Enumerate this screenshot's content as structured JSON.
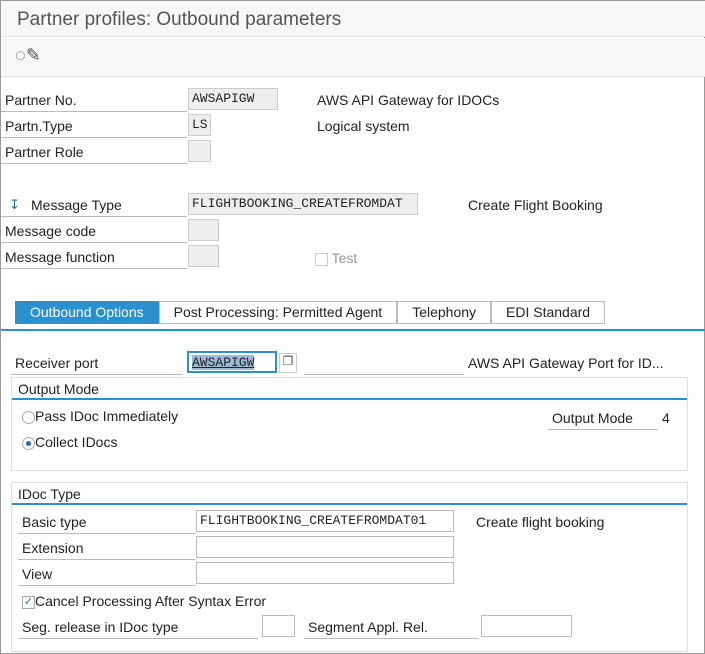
{
  "title": "Partner profiles: Outbound parameters",
  "toolbar": {
    "display_change_icon": "glasses-pencil-icon"
  },
  "header": {
    "partner_no_label": "Partner No.",
    "partner_no": "AWSAPIGW",
    "partner_no_desc": "AWS API Gateway for IDOCs",
    "partn_type_label": "Partn.Type",
    "partn_type": "LS",
    "partn_type_desc": "Logical system",
    "partner_role_label": "Partner Role",
    "partner_role": "",
    "message_type_label": "Message Type",
    "message_type": "FLIGHTBOOKING_CREATEFROMDAT",
    "message_type_desc": "Create Flight Booking",
    "message_code_label": "Message code",
    "message_function_label": "Message function",
    "test_label": "Test"
  },
  "tabs": [
    "Outbound Options",
    "Post Processing: Permitted Agent",
    "Telephony",
    "EDI Standard"
  ],
  "outbound": {
    "receiver_port_label": "Receiver port",
    "receiver_port": "AWSAPIGW",
    "receiver_port_desc": "AWS API Gateway Port for ID...",
    "output_mode_title": "Output Mode",
    "pass_immediately": "Pass IDoc Immediately",
    "collect": "Collect IDocs",
    "output_mode_label": "Output Mode",
    "output_mode_value": "4",
    "idoc_type_title": "IDoc Type",
    "basic_type_label": "Basic type",
    "basic_type": "FLIGHTBOOKING_CREATEFROMDAT01",
    "basic_type_desc": "Create flight booking",
    "extension_label": "Extension",
    "view_label": "View",
    "cancel_label": "Cancel Processing After Syntax Error",
    "seg_release_label": "Seg. release in IDoc type",
    "segment_appl_label": "Segment Appl. Rel."
  }
}
